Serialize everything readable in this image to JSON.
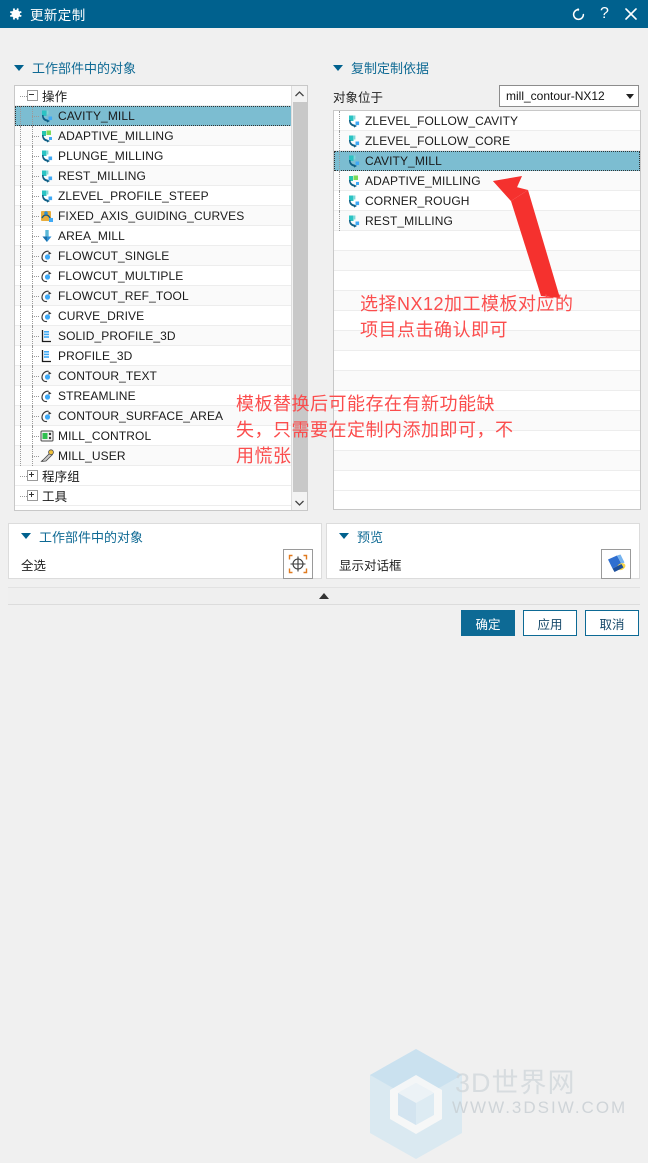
{
  "window": {
    "title": "更新定制",
    "icon": "gear-icon",
    "controls": [
      {
        "name": "reset-icon",
        "glyph": "↻"
      },
      {
        "name": "help-icon",
        "glyph": "?"
      },
      {
        "name": "close-icon",
        "glyph": "✕"
      }
    ],
    "titlebar_color": "#00618e"
  },
  "left_panel": {
    "header": "工作部件中的对象",
    "tree": {
      "root": {
        "label": "操作",
        "expander": "minus"
      },
      "items": [
        {
          "label": "CAVITY_MILL",
          "icon": "cavity-mill-icon",
          "selected": true
        },
        {
          "label": "ADAPTIVE_MILLING",
          "icon": "adaptive-milling-icon",
          "selected": false
        },
        {
          "label": "PLUNGE_MILLING",
          "icon": "plunge-milling-icon",
          "selected": false
        },
        {
          "label": "REST_MILLING",
          "icon": "rest-milling-icon",
          "selected": false
        },
        {
          "label": "ZLEVEL_PROFILE_STEEP",
          "icon": "zlevel-profile-icon",
          "selected": false
        },
        {
          "label": "FIXED_AXIS_GUIDING_CURVES",
          "icon": "fixed-axis-icon",
          "selected": false
        },
        {
          "label": "AREA_MILL",
          "icon": "area-mill-icon",
          "selected": false
        },
        {
          "label": "FLOWCUT_SINGLE",
          "icon": "flowcut-icon",
          "selected": false
        },
        {
          "label": "FLOWCUT_MULTIPLE",
          "icon": "flowcut-icon",
          "selected": false
        },
        {
          "label": "FLOWCUT_REF_TOOL",
          "icon": "flowcut-icon",
          "selected": false
        },
        {
          "label": "CURVE_DRIVE",
          "icon": "flowcut-icon",
          "selected": false
        },
        {
          "label": "SOLID_PROFILE_3D",
          "icon": "profile3d-icon",
          "selected": false
        },
        {
          "label": "PROFILE_3D",
          "icon": "profile3d-icon",
          "selected": false
        },
        {
          "label": "CONTOUR_TEXT",
          "icon": "flowcut-icon",
          "selected": false
        },
        {
          "label": "STREAMLINE",
          "icon": "flowcut-icon",
          "selected": false
        },
        {
          "label": "CONTOUR_SURFACE_AREA",
          "icon": "flowcut-icon",
          "selected": false
        },
        {
          "label": "MILL_CONTROL",
          "icon": "mill-control-icon",
          "selected": false
        },
        {
          "label": "MILL_USER",
          "icon": "mill-user-icon",
          "selected": false
        }
      ],
      "groups": [
        {
          "label": "程序组",
          "expander": "plus"
        },
        {
          "label": "工具",
          "expander": "plus"
        }
      ]
    }
  },
  "right_panel": {
    "header": "复制定制依据",
    "object_in_label": "对象位于",
    "template_select": {
      "value": "mill_contour-NX12",
      "icon": "chevron-down-icon"
    },
    "items": [
      {
        "label": "ZLEVEL_FOLLOW_CAVITY",
        "icon": "cavity-mill-icon",
        "selected": false
      },
      {
        "label": "ZLEVEL_FOLLOW_CORE",
        "icon": "cavity-mill-icon",
        "selected": false
      },
      {
        "label": "CAVITY_MILL",
        "icon": "cavity-mill-icon",
        "selected": true
      },
      {
        "label": "ADAPTIVE_MILLING",
        "icon": "adaptive-milling-icon",
        "selected": false
      },
      {
        "label": "CORNER_ROUGH",
        "icon": "cavity-mill-icon",
        "selected": false
      },
      {
        "label": "REST_MILLING",
        "icon": "cavity-mill-icon",
        "selected": false
      }
    ]
  },
  "annotations": {
    "color": "#fb4d4d",
    "note1": "选择NX12加工模板对应的\n项目点击确认即可",
    "note2": "模板替换后可能存在有新功能缺\n失，只需要在定制内添加即可，不\n用慌张",
    "arrow": "red-arrow-pointer"
  },
  "bottom_left": {
    "header": "工作部件中的对象",
    "row_label": "全选",
    "button_icon": "select-all-target-icon"
  },
  "bottom_right": {
    "header": "预览",
    "row_label": "显示对话框",
    "button_icon": "flashlight-icon"
  },
  "collapse_strip": {
    "icon": "chevron-up-icon"
  },
  "footer": {
    "buttons": [
      {
        "label": "确定",
        "primary": true,
        "name": "ok-button"
      },
      {
        "label": "应用",
        "primary": false,
        "name": "apply-button"
      },
      {
        "label": "取消",
        "primary": false,
        "name": "cancel-button"
      }
    ]
  },
  "watermark": {
    "logo": "3d-cube-hex-logo",
    "text": "3D世界网",
    "url": "WWW.3DSIW.COM"
  }
}
